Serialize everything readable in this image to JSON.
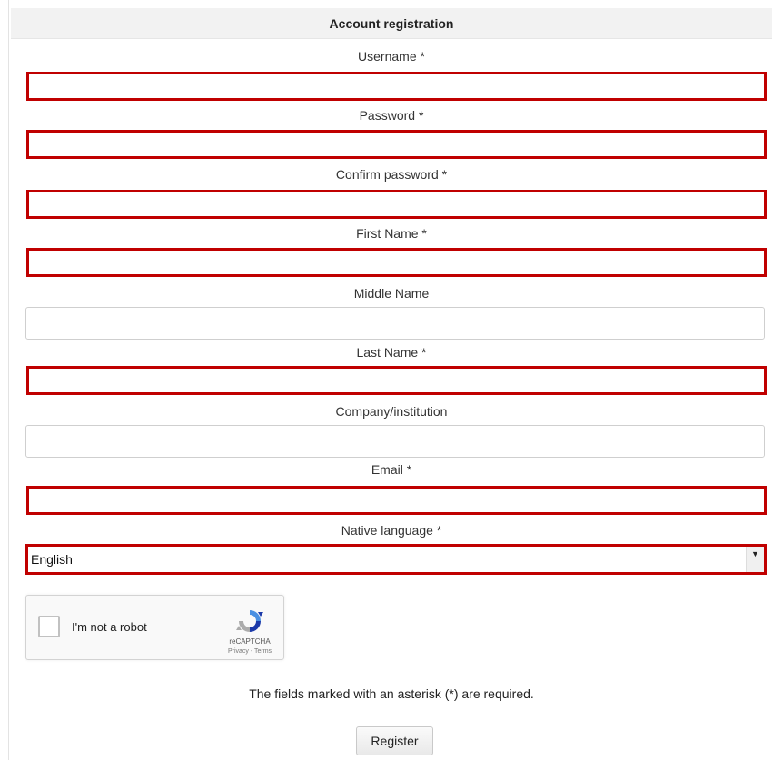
{
  "header": {
    "title": "Account registration"
  },
  "form": {
    "username_label": "Username *",
    "password_label": "Password *",
    "confirm_password_label": "Confirm password *",
    "first_name_label": "First Name *",
    "middle_name_label": "Middle Name",
    "last_name_label": "Last Name *",
    "company_label": "Company/institution",
    "email_label": "Email *",
    "native_language_label": "Native language *",
    "native_language_value": "English",
    "username_value": "",
    "password_value": "",
    "confirm_password_value": "",
    "first_name_value": "",
    "middle_name_value": "",
    "last_name_value": "",
    "company_value": "",
    "email_value": ""
  },
  "captcha": {
    "checkbox_label": "I'm not a robot",
    "brand": "reCAPTCHA",
    "links": "Privacy - Terms",
    "icon": "recaptcha-logo-icon"
  },
  "footer": {
    "required_note": "The fields marked with an asterisk (*) are required.",
    "register_label": "Register"
  },
  "colors": {
    "required_highlight": "#c00000",
    "header_bg": "#f2f2f2"
  }
}
